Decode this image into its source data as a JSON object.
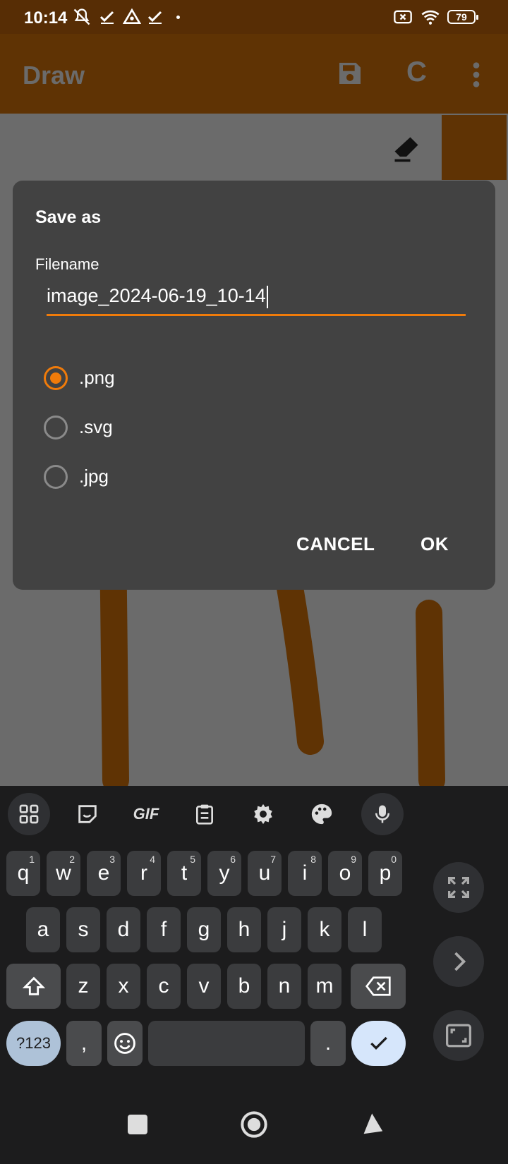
{
  "status_bar": {
    "time": "10:14",
    "battery": "79"
  },
  "app_bar": {
    "title": "Draw",
    "c_label": "C"
  },
  "dialog": {
    "title": "Save as",
    "filename_label": "Filename",
    "filename_value": "image_2024-06-19_10-14",
    "options": [
      {
        "label": ".png",
        "selected": true
      },
      {
        "label": ".svg",
        "selected": false
      },
      {
        "label": ".jpg",
        "selected": false
      }
    ],
    "cancel": "CANCEL",
    "ok": "OK"
  },
  "keyboard": {
    "tool_gif": "GIF",
    "row1": [
      {
        "k": "q",
        "n": "1"
      },
      {
        "k": "w",
        "n": "2"
      },
      {
        "k": "e",
        "n": "3"
      },
      {
        "k": "r",
        "n": "4"
      },
      {
        "k": "t",
        "n": "5"
      },
      {
        "k": "y",
        "n": "6"
      },
      {
        "k": "u",
        "n": "7"
      },
      {
        "k": "i",
        "n": "8"
      },
      {
        "k": "o",
        "n": "9"
      },
      {
        "k": "p",
        "n": "0"
      }
    ],
    "row2": [
      "a",
      "s",
      "d",
      "f",
      "g",
      "h",
      "j",
      "k",
      "l"
    ],
    "row3": [
      "z",
      "x",
      "c",
      "v",
      "b",
      "n",
      "m"
    ],
    "symbols": "?123",
    "comma": ",",
    "period": "."
  },
  "colors": {
    "accent": "#f07b0a",
    "brown": "#5f3304",
    "canvas": "#6b6b6b",
    "dialog": "#424242"
  }
}
